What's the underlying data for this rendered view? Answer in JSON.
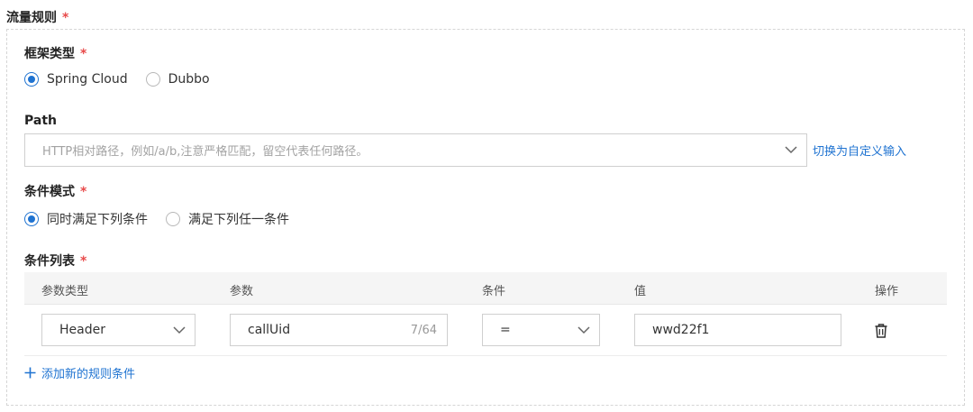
{
  "section": {
    "title": "流量规则",
    "required_mark": "*"
  },
  "framework": {
    "label": "框架类型",
    "required_mark": "*",
    "options": [
      "Spring Cloud",
      "Dubbo"
    ],
    "selected": "Spring Cloud"
  },
  "path": {
    "label": "Path",
    "placeholder": "HTTP相对路径，例如/a/b,注意严格匹配，留空代表任何路径。",
    "switch_link": "切换为自定义输入"
  },
  "condition_mode": {
    "label": "条件模式",
    "required_mark": "*",
    "options": [
      "同时满足下列条件",
      "满足下列任一条件"
    ],
    "selected": "同时满足下列条件"
  },
  "condition_list": {
    "label": "条件列表",
    "required_mark": "*",
    "columns": [
      "参数类型",
      "参数",
      "条件",
      "值",
      "操作"
    ],
    "rows": [
      {
        "param_type": "Header",
        "param": "callUid",
        "param_count": "7/64",
        "operator": "=",
        "value": "wwd22f1"
      }
    ],
    "add_label": "添加新的规则条件"
  },
  "icons": {
    "chevron": "chevron-down-icon",
    "trash": "trash-icon",
    "plus": "plus-icon"
  },
  "colors": {
    "accent": "#1f73d1",
    "required": "#e84a4a"
  }
}
